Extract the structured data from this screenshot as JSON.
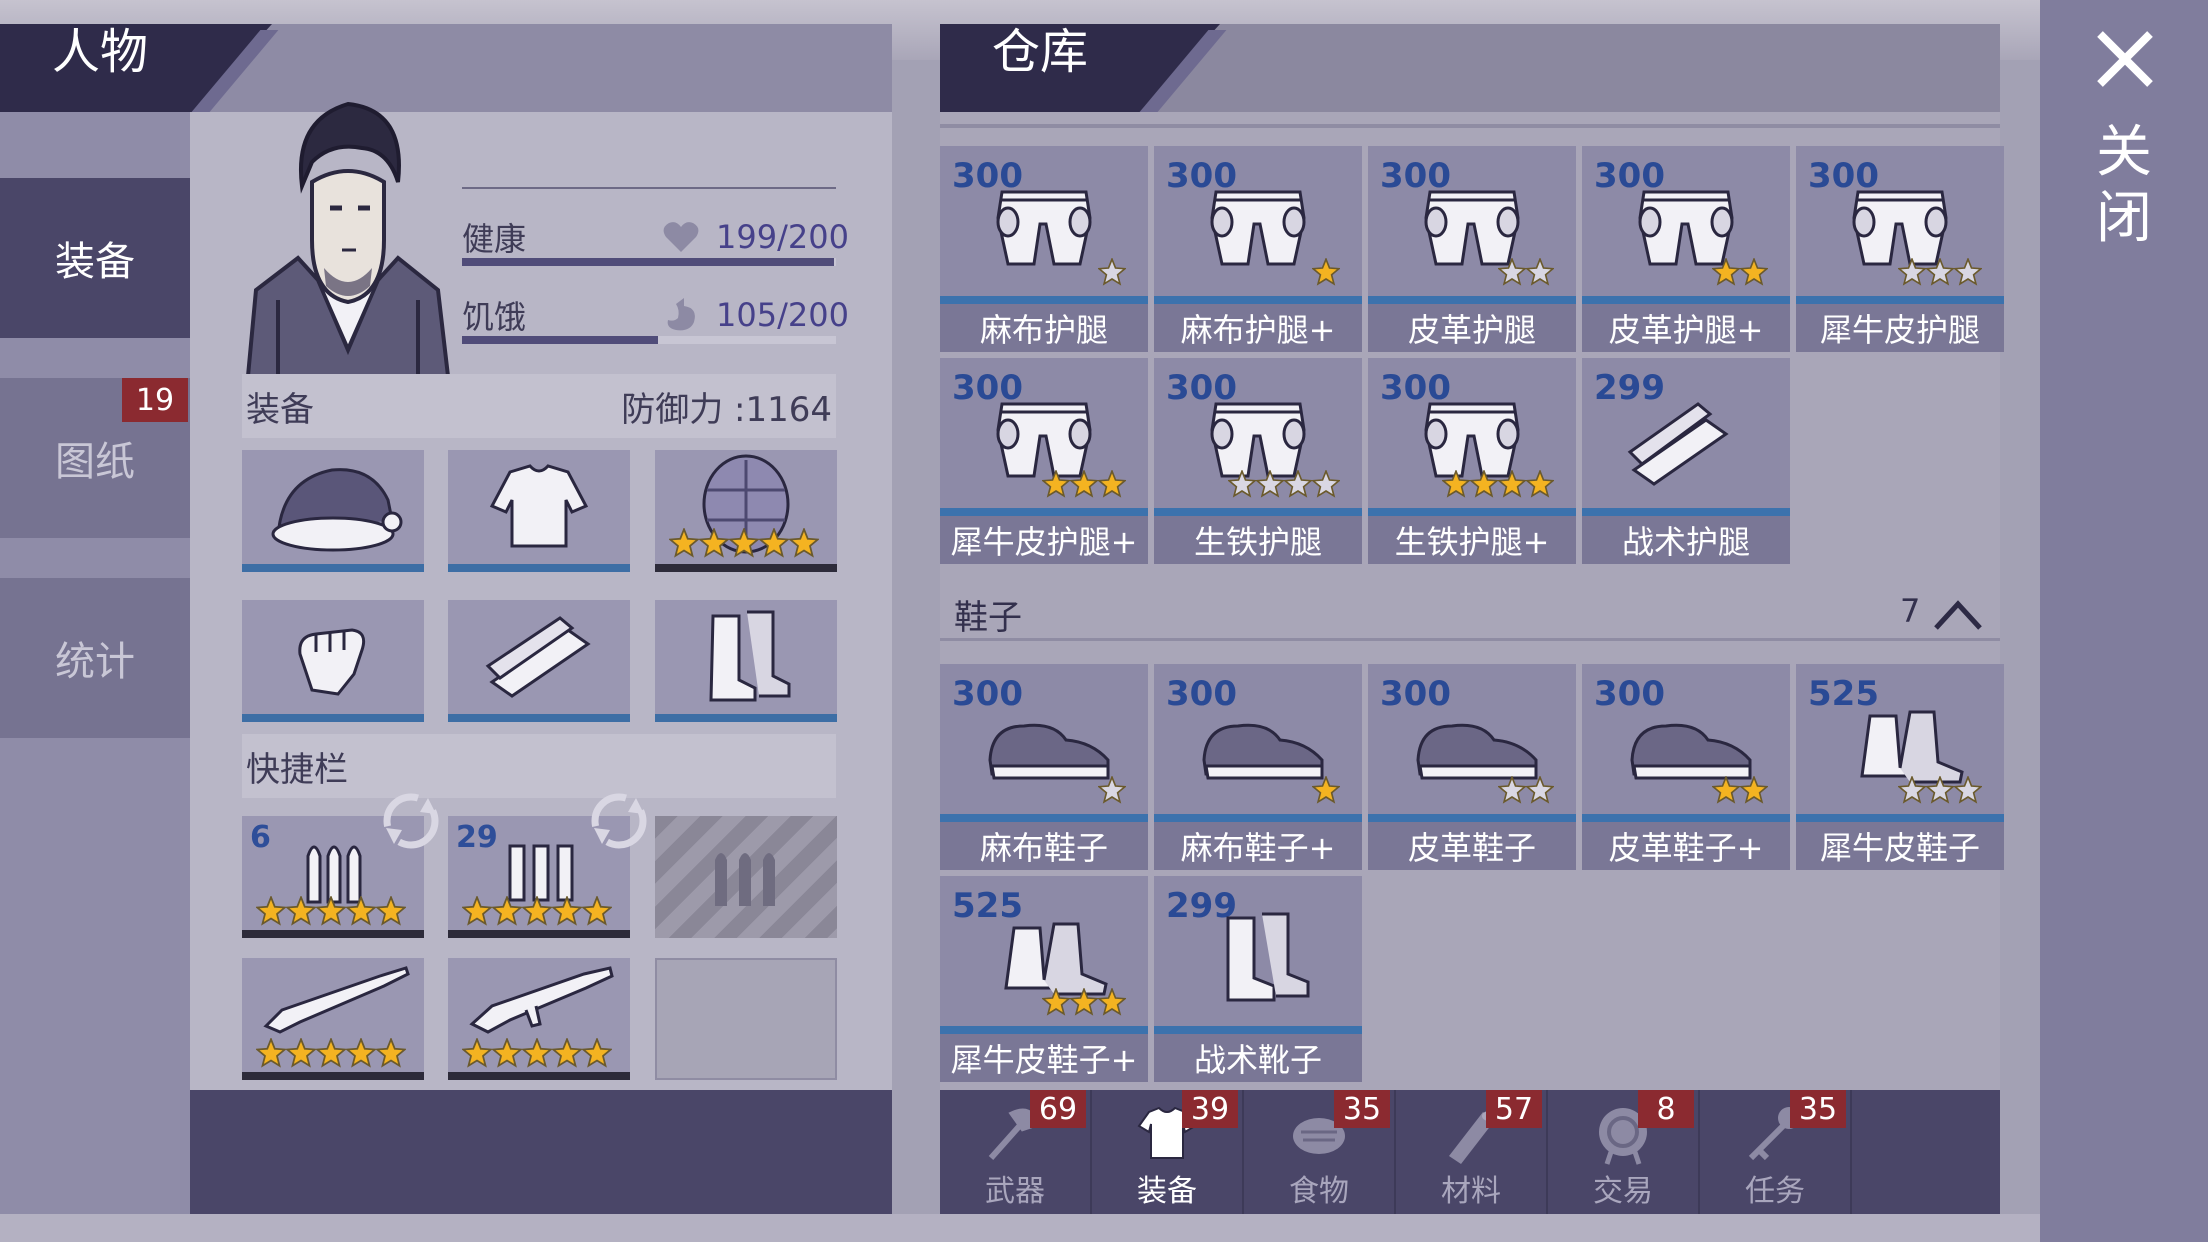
{
  "colors": {
    "accent_blue": "#3c72ad",
    "value_blue": "#2a4a95",
    "badge_red": "#8b2a30",
    "dark_panel": "#4a4668",
    "star_gold": "#f4b321",
    "star_grey": "#d9d7e3"
  },
  "character": {
    "title": "人物",
    "tabs": [
      {
        "label": "装备",
        "active": true
      },
      {
        "label": "图纸",
        "badge": "19"
      },
      {
        "label": "统计"
      }
    ],
    "stats": [
      {
        "label": "健康",
        "icon": "heart-icon",
        "value": "199/200",
        "fraction": 0.995
      },
      {
        "label": "饥饿",
        "icon": "stomach-icon",
        "value": "105/200",
        "fraction": 0.525
      }
    ],
    "equipment": {
      "label": "装备",
      "defense": "防御力 :1164",
      "slots": [
        {
          "icon": "santa-hat-icon",
          "stars": 0
        },
        {
          "icon": "shirt-icon",
          "stars": 0
        },
        {
          "icon": "turtle-shell-icon",
          "stars": 5
        },
        {
          "icon": "gloves-icon",
          "stars": 0
        },
        {
          "icon": "leg-guard-icon",
          "stars": 0
        },
        {
          "icon": "boots-icon",
          "stars": 0
        }
      ]
    },
    "quickbar": {
      "label": "快捷栏",
      "slots": [
        {
          "icon": "bullets-icon",
          "count": "6",
          "stars": 5
        },
        {
          "icon": "shells-icon",
          "count": "29",
          "stars": 5
        },
        {
          "icon": "locked-ammo-icon",
          "locked": true
        },
        {
          "icon": "rifle-icon",
          "stars": 5
        },
        {
          "icon": "shotgun-icon",
          "stars": 5
        },
        {
          "icon": "empty-slot",
          "empty": true
        }
      ]
    }
  },
  "warehouse": {
    "title": "仓库",
    "leg_items": [
      {
        "value": "300",
        "name": "麻布护腿",
        "stars": 1,
        "filled": 0
      },
      {
        "value": "300",
        "name": "麻布护腿+",
        "stars": 1,
        "filled": 1
      },
      {
        "value": "300",
        "name": "皮革护腿",
        "stars": 2,
        "filled": 0
      },
      {
        "value": "300",
        "name": "皮革护腿+",
        "stars": 2,
        "filled": 2
      },
      {
        "value": "300",
        "name": "犀牛皮护腿",
        "stars": 3,
        "filled": 0
      },
      {
        "value": "300",
        "name": "犀牛皮护腿+",
        "stars": 3,
        "filled": 3
      },
      {
        "value": "300",
        "name": "生铁护腿",
        "stars": 4,
        "filled": 0
      },
      {
        "value": "300",
        "name": "生铁护腿+",
        "stars": 4,
        "filled": 4
      },
      {
        "value": "299",
        "name": "战术护腿",
        "stars": 0,
        "filled": 0
      }
    ],
    "shoes_category": {
      "label": "鞋子",
      "count": "7"
    },
    "shoe_items": [
      {
        "value": "300",
        "name": "麻布鞋子",
        "stars": 1,
        "filled": 0
      },
      {
        "value": "300",
        "name": "麻布鞋子+",
        "stars": 1,
        "filled": 1
      },
      {
        "value": "300",
        "name": "皮革鞋子",
        "stars": 2,
        "filled": 0
      },
      {
        "value": "300",
        "name": "皮革鞋子+",
        "stars": 2,
        "filled": 2
      },
      {
        "value": "525",
        "name": "犀牛皮鞋子",
        "stars": 3,
        "filled": 0
      },
      {
        "value": "525",
        "name": "犀牛皮鞋子+",
        "stars": 3,
        "filled": 3
      },
      {
        "value": "299",
        "name": "战术靴子",
        "stars": 0,
        "filled": 0
      }
    ],
    "bottom_tabs": [
      {
        "label": "武器",
        "badge": "69",
        "icon": "axe-icon",
        "active": false
      },
      {
        "label": "装备",
        "badge": "39",
        "icon": "tshirt-icon",
        "active": true
      },
      {
        "label": "食物",
        "badge": "35",
        "icon": "food-icon",
        "active": false
      },
      {
        "label": "材料",
        "badge": "57",
        "icon": "wood-icon",
        "active": false
      },
      {
        "label": "交易",
        "badge": "8",
        "icon": "trade-icon",
        "active": false
      },
      {
        "label": "任务",
        "badge": "35",
        "icon": "key-icon",
        "active": false
      }
    ]
  },
  "close": {
    "label": "关闭"
  }
}
